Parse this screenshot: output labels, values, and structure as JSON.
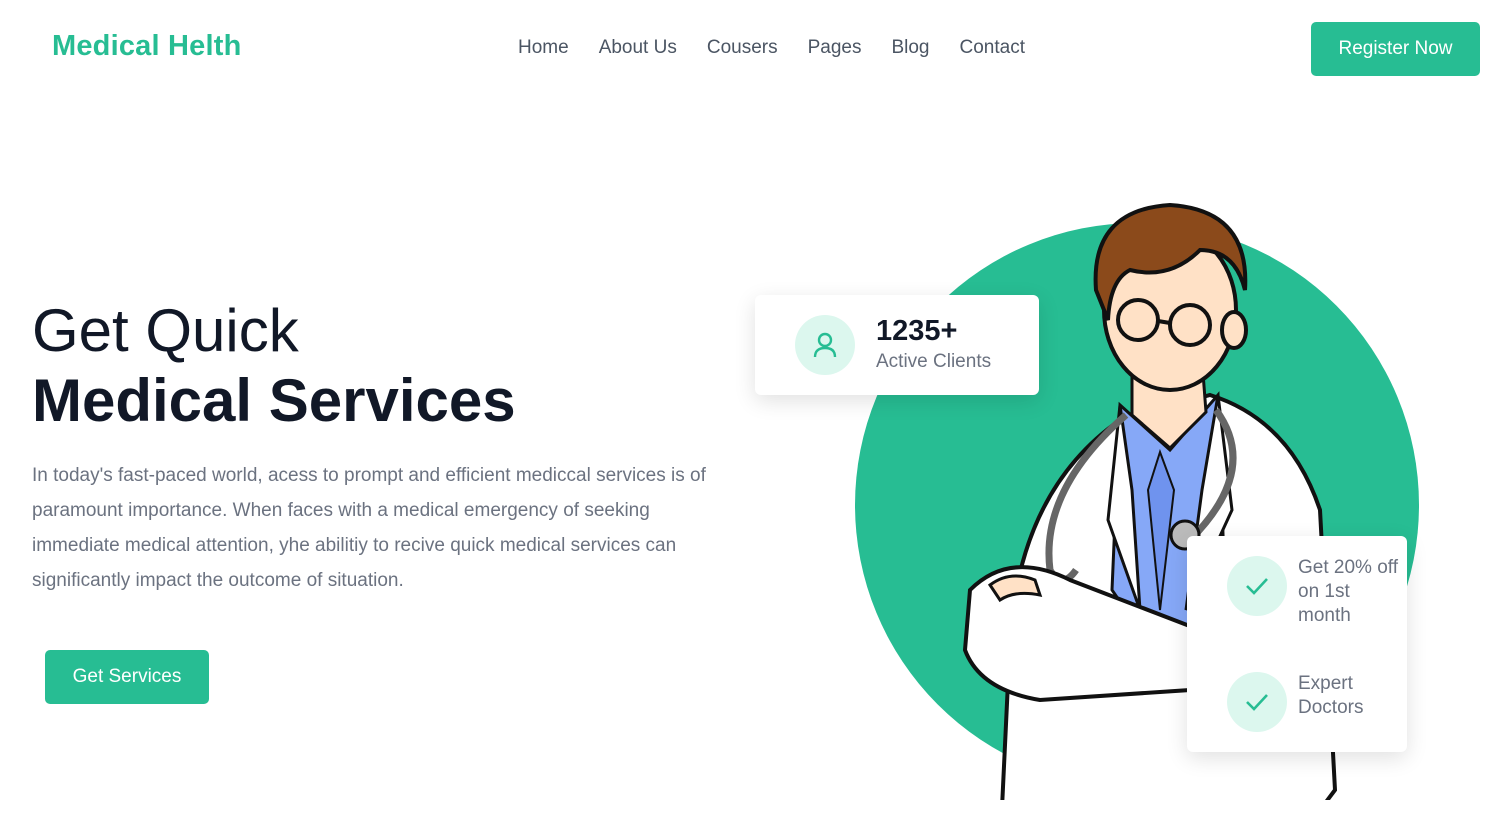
{
  "nav": {
    "brand": "Medical Helth",
    "links": [
      "Home",
      "About Us",
      "Cousers",
      "Pages",
      "Blog",
      "Contact"
    ],
    "register_label": "Register Now"
  },
  "hero": {
    "title_line1": "Get Quick",
    "title_line2": "Medical Services",
    "description": "In today's fast-paced world, acess to prompt and efficient mediccal services is of paramount importance. When faces with a medical emergency of seeking immediate medical attention, yhe abilitiy to recive quick medical services can significantly impact the outcome of situation.",
    "cta_label": "Get Services"
  },
  "stats_card": {
    "number": "1235+",
    "label": "Active Clients",
    "icon": "user-icon"
  },
  "offers_card": {
    "items": [
      {
        "text": "Get 20% off on 1st month",
        "icon": "check-icon"
      },
      {
        "text": "Expert Doctors",
        "icon": "check-icon"
      }
    ]
  },
  "colors": {
    "brand": "#27bd93",
    "heading": "#111827",
    "body_text": "#6b7280",
    "icon_bg": "#dcf7ee"
  }
}
